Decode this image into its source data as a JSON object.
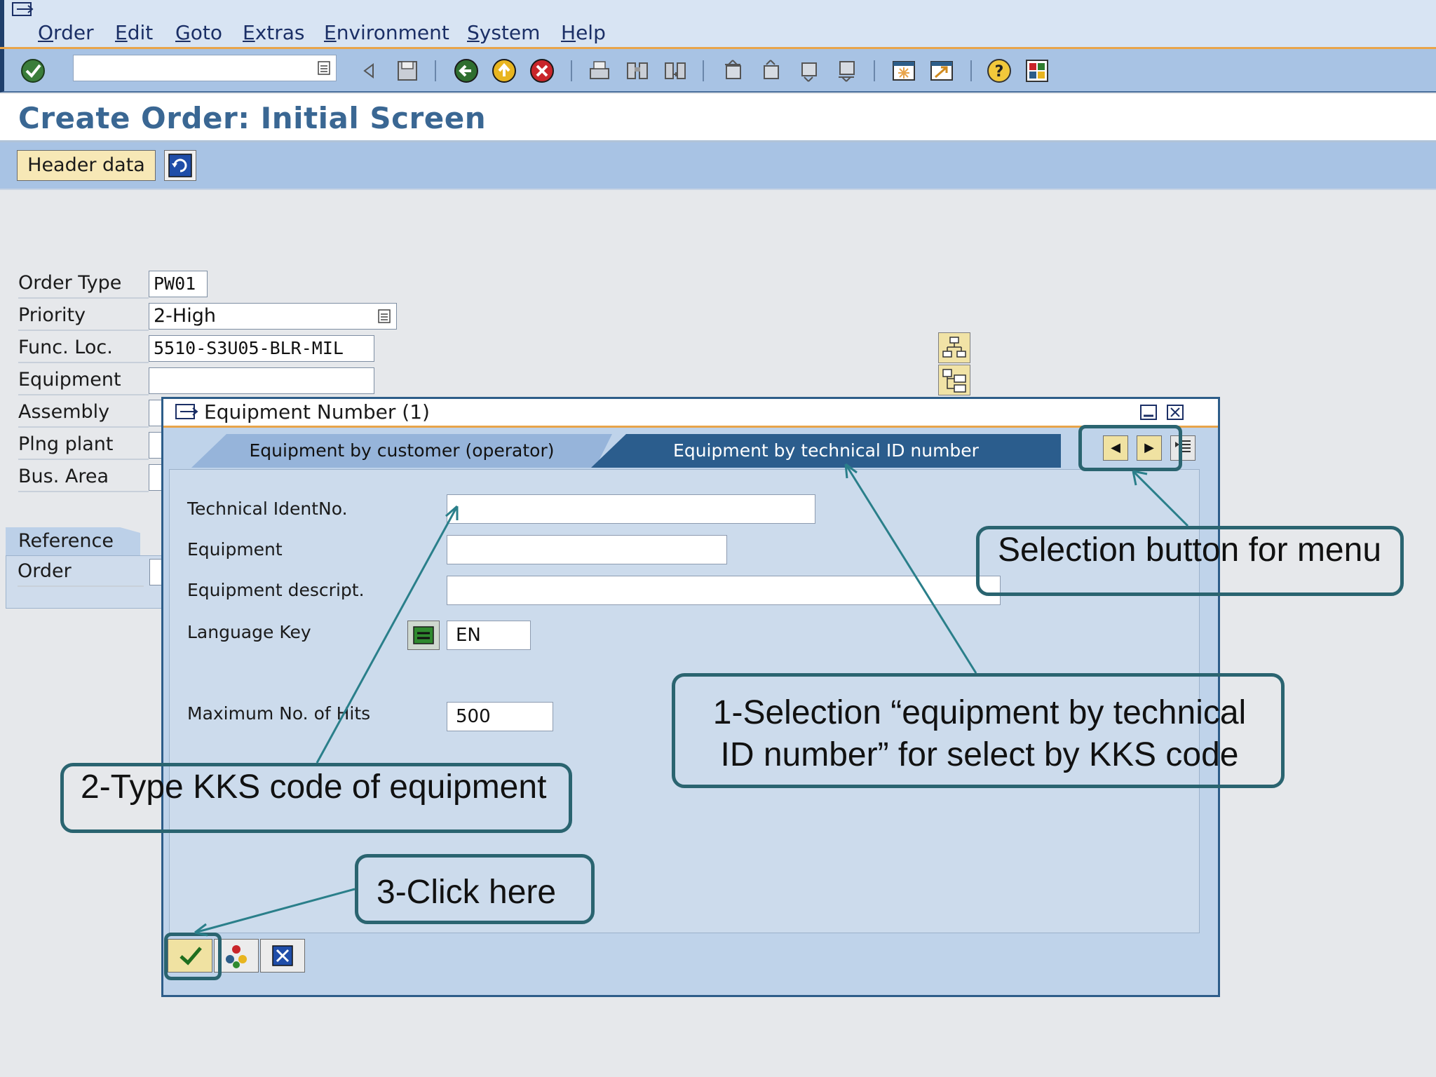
{
  "menu": [
    "Order",
    "Edit",
    "Goto",
    "Extras",
    "Environment",
    "System",
    "Help"
  ],
  "page_title": "Create Order: Initial Screen",
  "app_toolbar": {
    "header_button": "Header data"
  },
  "form": {
    "fields": [
      {
        "label": "Order Type",
        "value": "PW01"
      },
      {
        "label": "Priority",
        "value": "2-High"
      },
      {
        "label": "Func. Loc.",
        "value": "5510-S3U05-BLR-MIL"
      },
      {
        "label": "Equipment",
        "value": ""
      },
      {
        "label": "Assembly",
        "value": ""
      },
      {
        "label": "Plng plant",
        "value": ""
      },
      {
        "label": "Bus. Area",
        "value": ""
      }
    ],
    "reference_tab": "Reference",
    "reference_order_label": "Order"
  },
  "dialog": {
    "title": "Equipment Number (1)",
    "tabs": [
      "Equipment by customer (operator)",
      "Equipment by technical ID number"
    ],
    "fields": [
      {
        "label": "Technical IdentNo.",
        "value": ""
      },
      {
        "label": "Equipment",
        "value": ""
      },
      {
        "label": "Equipment descript.",
        "value": ""
      },
      {
        "label": "Language Key",
        "value": "EN"
      },
      {
        "label": "Maximum No. of Hits",
        "value": "500"
      }
    ]
  },
  "callouts": {
    "menu_button": "Selection button for menu",
    "step1": "1-Selection “equipment by technical ID number” for select by KKS code",
    "step2": "2-Type KKS code of equipment",
    "step3": "3-Click here"
  },
  "colors": {
    "toolbar_bg": "#a8c3e4",
    "title_text": "#3a6793",
    "accent_orange": "#e8a44a",
    "active_tab": "#2b5d8d",
    "callout_border": "#2a6470"
  }
}
